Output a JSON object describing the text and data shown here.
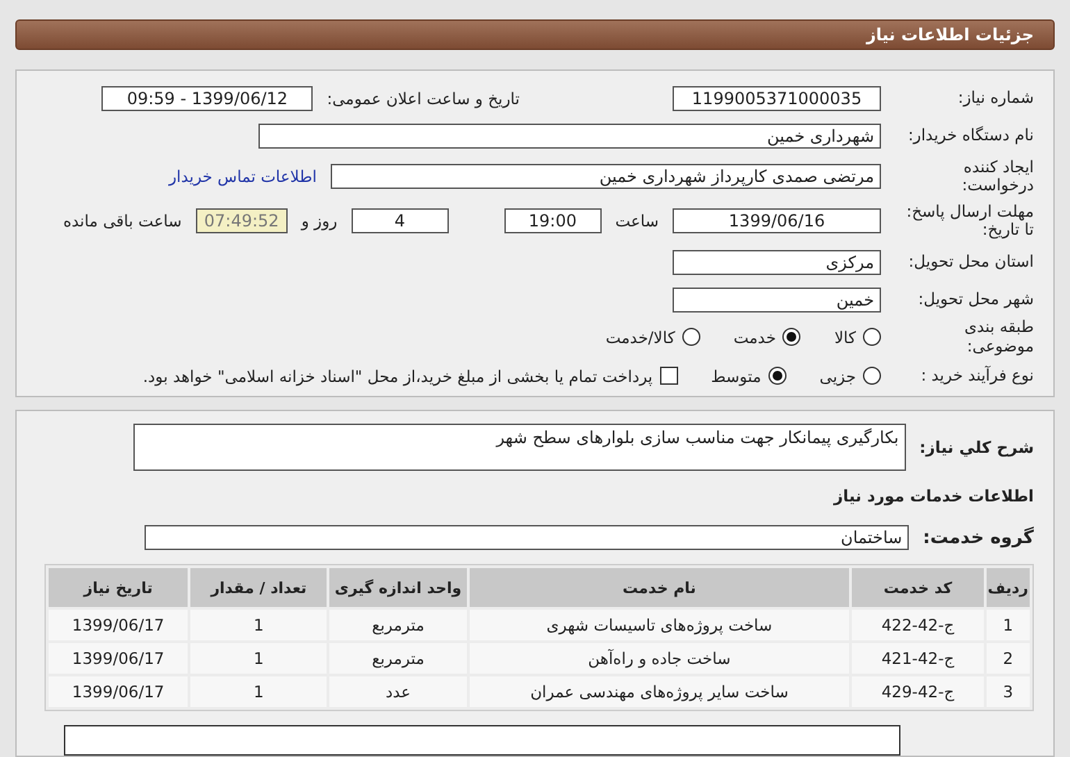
{
  "header": {
    "title": "جزئیات اطلاعات نیاز"
  },
  "details": {
    "need_number": {
      "label": "شماره نیاز:",
      "value": "1199005371000035"
    },
    "announce": {
      "label": "تاریخ و ساعت اعلان عمومی:",
      "value": "1399/06/12 - 09:59"
    },
    "buyer": {
      "label": "نام دستگاه خریدار:",
      "value": "شهرداری خمین"
    },
    "requester": {
      "label": "ایجاد کننده درخواست:",
      "value": "مرتضی صمدی کارپرداز شهرداری خمین"
    },
    "contact_link": "اطلاعات تماس خریدار",
    "deadline": {
      "label": "مهلت ارسال پاسخ: تا تاریخ:",
      "date": "1399/06/16",
      "time_label": "ساعت",
      "time": "19:00",
      "days": "4",
      "days_label": "روز و",
      "remaining": "07:49:52",
      "remaining_label": "ساعت باقی مانده"
    },
    "province": {
      "label": "استان محل تحویل:",
      "value": "مرکزی"
    },
    "city": {
      "label": "شهر محل تحویل:",
      "value": "خمین"
    },
    "category": {
      "label": "طبقه بندی موضوعی:",
      "options": [
        {
          "label": "کالا",
          "selected": false
        },
        {
          "label": "خدمت",
          "selected": true
        },
        {
          "label": "کالا/خدمت",
          "selected": false
        }
      ]
    },
    "process": {
      "label": "نوع فرآیند خرید :",
      "options": [
        {
          "label": "جزیی",
          "selected": false
        },
        {
          "label": "متوسط",
          "selected": true
        }
      ],
      "payment": {
        "label": "پرداخت تمام یا بخشی از مبلغ خرید،از محل \"اسناد خزانه اسلامی\" خواهد بود.",
        "checked": false
      }
    }
  },
  "description": {
    "label": "شرح کلي نياز:",
    "value": "بکارگیری پیمانکار جهت مناسب سازی بلوارهای سطح شهر"
  },
  "services_heading": "اطلاعات خدمات مورد نیاز",
  "service_group": {
    "label": "گروه خدمت:",
    "value": "ساختمان"
  },
  "table": {
    "columns": [
      "ردیف",
      "کد خدمت",
      "نام خدمت",
      "واحد اندازه گیری",
      "تعداد / مقدار",
      "تاریخ نیاز"
    ],
    "rows": [
      [
        "1",
        "ج-42-422",
        "ساخت پروژه‌های تاسیسات شهری",
        "مترمربع",
        "1",
        "1399/06/17"
      ],
      [
        "2",
        "ج-42-421",
        "ساخت جاده و راه‌آهن",
        "مترمربع",
        "1",
        "1399/06/17"
      ],
      [
        "3",
        "ج-42-429",
        "ساخت سایر پروژه‌های مهندسی عمران",
        "عدد",
        "1",
        "1399/06/17"
      ]
    ]
  }
}
